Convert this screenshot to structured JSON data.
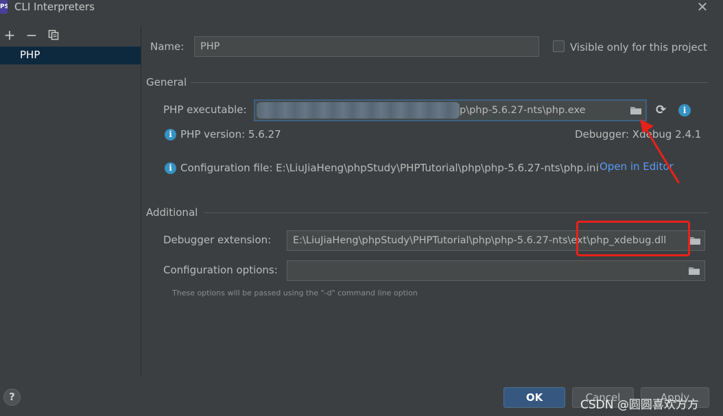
{
  "window": {
    "title": "CLI Interpreters",
    "app_icon_text": "PS",
    "close_glyph": "✕"
  },
  "toolbar": {
    "add_glyph": "+",
    "remove_glyph": "−",
    "copy_icon": "copy-icon"
  },
  "interpreters": {
    "items": [
      {
        "label": "PHP",
        "selected": true
      }
    ]
  },
  "form": {
    "name_label": "Name:",
    "name_value": "PHP",
    "visible_only_label": "Visible only for this project",
    "visible_only_checked": false
  },
  "general": {
    "title": "General",
    "php_executable_label": "PHP executable:",
    "php_executable_value": "p\\php-5.6.27-nts\\php.exe",
    "php_version_text": "PHP version: 5.6.27",
    "debugger_text": "Debugger: Xdebug 2.4.1",
    "config_file_text": "Configuration file: E:\\LiuJiaHeng\\phpStudy\\PHPTutorial\\php\\php-5.6.27-nts\\php.ini",
    "open_in_editor_label": "Open in Editor",
    "refresh_glyph": "⟳",
    "info_glyph": "i"
  },
  "additional": {
    "title": "Additional",
    "debugger_extension_label": "Debugger extension:",
    "debugger_extension_value": "E:\\LiuJiaHeng\\phpStudy\\PHPTutorial\\php\\php-5.6.27-nts\\ext\\php_xdebug.dll",
    "config_options_label": "Configuration options:",
    "config_options_value": "",
    "hint": "These options will be passed using the \"-d\" command line option"
  },
  "footer": {
    "help_glyph": "?",
    "ok_label": "OK",
    "cancel_label": "Cancel",
    "apply_label": "Apply",
    "watermark": "CSDN @圆圆喜欢方方"
  },
  "colors": {
    "background": "#3c3f41",
    "selection": "#0d293e",
    "accent": "#365880",
    "link": "#589df6",
    "annotation": "#e8211a"
  }
}
